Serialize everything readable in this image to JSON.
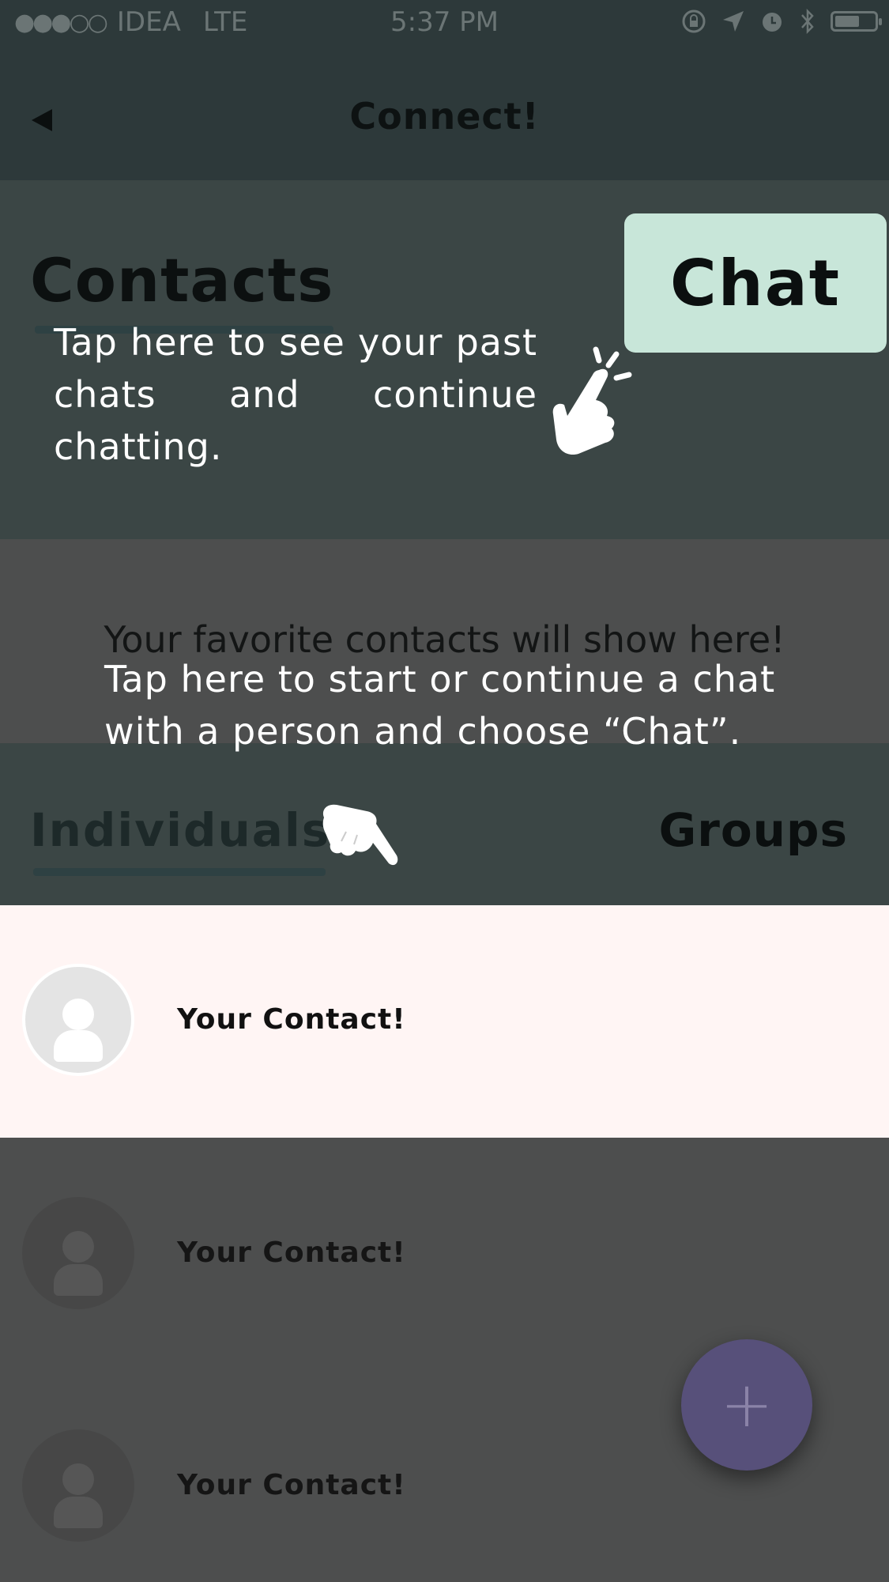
{
  "status_bar": {
    "signal": "●●●○○",
    "carrier": "IDEA",
    "network": "LTE",
    "time": "5:37 PM"
  },
  "nav": {
    "title": "Connect!"
  },
  "contacts_section": {
    "title": "Contacts",
    "chat_button": "Chat"
  },
  "tips": {
    "chat_tip": "Tap here to see your past chats and continue chatting.",
    "person_tip": "Tap here to start or continue a chat with a person and choose “Chat”."
  },
  "favorites": {
    "empty_text": "Your favorite contacts will show here!"
  },
  "tabs": {
    "individuals": "Individuals",
    "groups": "Groups"
  },
  "contacts": [
    {
      "name": "Your Contact!"
    },
    {
      "name": "Your Contact!"
    },
    {
      "name": "Your Contact!"
    }
  ],
  "fab": {
    "icon": "plus-icon",
    "symbol": "+"
  }
}
